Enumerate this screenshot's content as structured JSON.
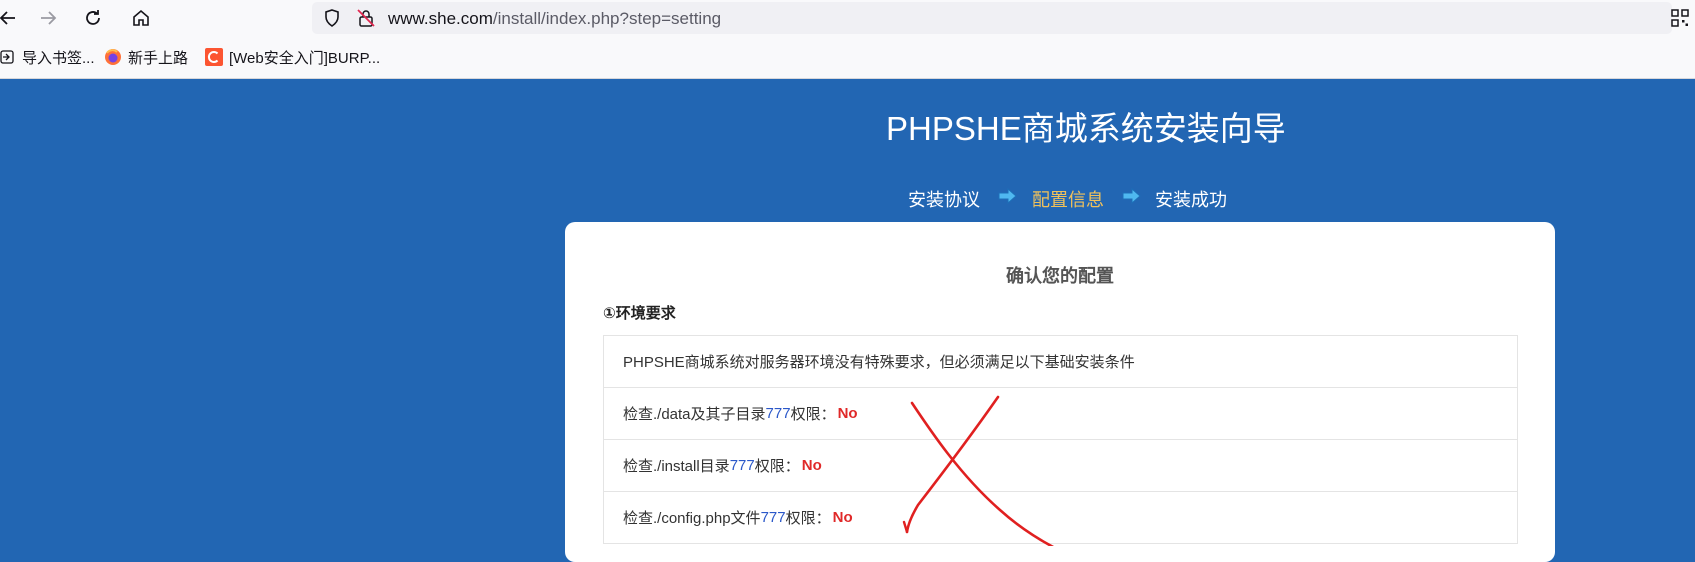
{
  "browser": {
    "url_host": "www.she.com",
    "url_path": "/install/index.php?step=setting",
    "bookmarks": [
      {
        "label": "导入书签...",
        "icon": "import-icon"
      },
      {
        "label": "新手上路",
        "icon": "firefox-icon"
      },
      {
        "label": "[Web安全入门]BURP...",
        "icon": "c-logo-icon"
      }
    ]
  },
  "page": {
    "title": "PHPSHE商城系统安装向导",
    "steps": [
      {
        "label": "安装协议",
        "active": false
      },
      {
        "label": "配置信息",
        "active": true
      },
      {
        "label": "安装成功",
        "active": false
      }
    ]
  },
  "card": {
    "title": "确认您的配置",
    "section_title": "①环境要求",
    "intro": "PHPSHE商城系统对服务器环境没有特殊要求，但必须满足以下基础安装条件",
    "checks": [
      {
        "prefix": "检查./data及其子目录",
        "perm": "777",
        "suffix": "权限：",
        "status": "No"
      },
      {
        "prefix": "检查./install目录",
        "perm": "777",
        "suffix": "权限：",
        "status": "No"
      },
      {
        "prefix": "检查./config.php文件",
        "perm": "777",
        "suffix": "权限：",
        "status": "No"
      }
    ]
  },
  "colors": {
    "page_bg": "#2266b3",
    "active_step": "#f0c15b",
    "status_no": "#e02929",
    "perm_number": "#2b58c9",
    "annotation_cross": "#e02020"
  }
}
